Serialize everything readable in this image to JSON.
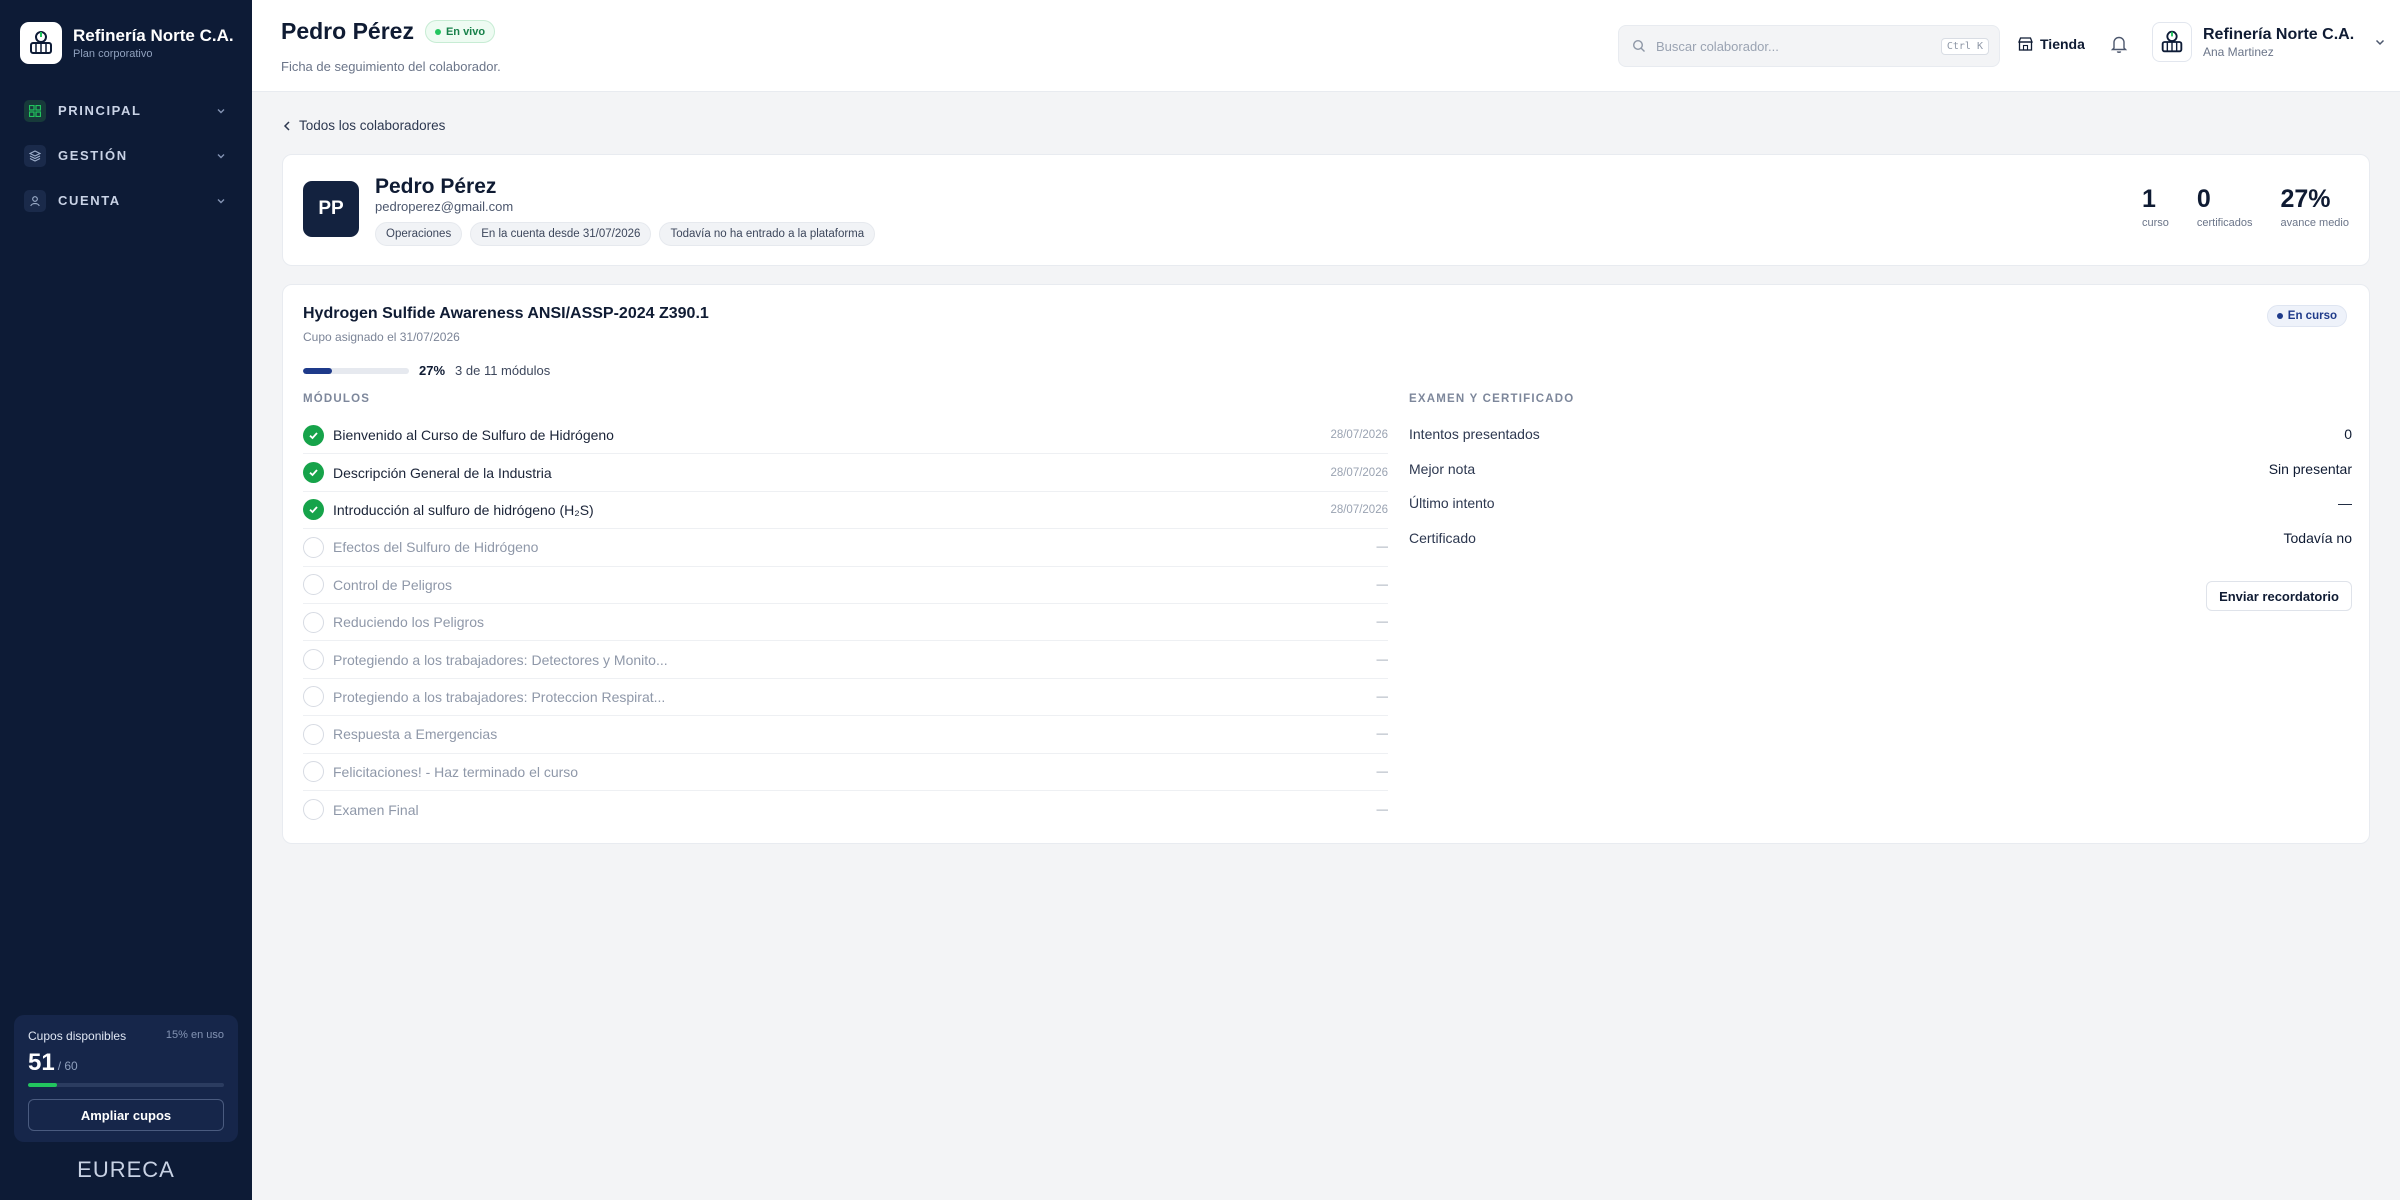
{
  "colors": {
    "sidebar": "#0d1b36",
    "accent": "#1e3a8a",
    "success": "#16a34a",
    "live": "#22c55e"
  },
  "brand": {
    "name": "Refinería Norte C.A.",
    "plan": "Plan corporativo"
  },
  "nav": [
    {
      "label": "PRINCIPAL",
      "icon": "grid-icon"
    },
    {
      "label": "GESTIÓN",
      "icon": "layers-icon"
    },
    {
      "label": "CUENTA",
      "icon": "user-icon"
    }
  ],
  "quota": {
    "label": "Cupos disponibles",
    "usage": "15% en uso",
    "available": "51",
    "total": "/ 60",
    "used_fraction": 0.15,
    "button": "Ampliar cupos"
  },
  "footer": {
    "logo": "EURECA"
  },
  "header": {
    "title": "Pedro Pérez",
    "live_badge": "En vivo",
    "subtitle": "Ficha de seguimiento del colaborador.",
    "search_placeholder": "Buscar colaborador...",
    "search_shortcut": "Ctrl K",
    "store": "Tienda",
    "account_name": "Refinería Norte C.A.",
    "account_user": "Ana Martinez"
  },
  "back_link": "Todos los colaboradores",
  "profile": {
    "initials": "PP",
    "name": "Pedro Pérez",
    "email": "pedroperez@gmail.com",
    "chips": [
      "Operaciones",
      "En la cuenta desde 31/07/2026",
      "Todavía no ha entrado a la plataforma"
    ],
    "stats": [
      {
        "value": "1",
        "label": "curso"
      },
      {
        "value": "0",
        "label": "certificados"
      },
      {
        "value": "27%",
        "label": "avance medio"
      }
    ]
  },
  "course": {
    "title": "Hydrogen Sulfide Awareness ANSI/ASSP-2024 Z390.1",
    "assigned": "Cupo asignado el 31/07/2026",
    "progress": 0.27,
    "progress_label": "27%",
    "modules_count": "3 de 11 módulos",
    "status": "En curso",
    "modules_title": "MÓDULOS",
    "modules": [
      {
        "label": "Bienvenido al Curso de Sulfuro de Hidrógeno",
        "done": true,
        "date": "28/07/2026"
      },
      {
        "label": "Descripción General de la Industria",
        "done": true,
        "date": "28/07/2026"
      },
      {
        "label": "Introducción al sulfuro de hidrógeno (H₂S)",
        "done": true,
        "date": "28/07/2026"
      },
      {
        "label": "Efectos del Sulfuro de Hidrógeno",
        "done": false,
        "date": "—"
      },
      {
        "label": "Control de Peligros",
        "done": false,
        "date": "—"
      },
      {
        "label": "Reduciendo los Peligros",
        "done": false,
        "date": "—"
      },
      {
        "label": "Protegiendo a los trabajadores: Detectores y Monito...",
        "done": false,
        "date": "—"
      },
      {
        "label": "Protegiendo a los trabajadores: Proteccion Respirat...",
        "done": false,
        "date": "—"
      },
      {
        "label": "Respuesta a Emergencias",
        "done": false,
        "date": "—"
      },
      {
        "label": "Felicitaciones! - Haz terminado el curso",
        "done": false,
        "date": "—"
      },
      {
        "label": "Examen Final",
        "done": false,
        "date": "—"
      }
    ],
    "exam_title": "EXAMEN Y CERTIFICADO",
    "exam": [
      {
        "label": "Intentos presentados",
        "value": "0"
      },
      {
        "label": "Mejor nota",
        "value": "Sin presentar"
      },
      {
        "label": "Último intento",
        "value": "—"
      },
      {
        "label": "Certificado",
        "value": "Todavía no"
      }
    ],
    "reminder_button": "Enviar recordatorio"
  }
}
